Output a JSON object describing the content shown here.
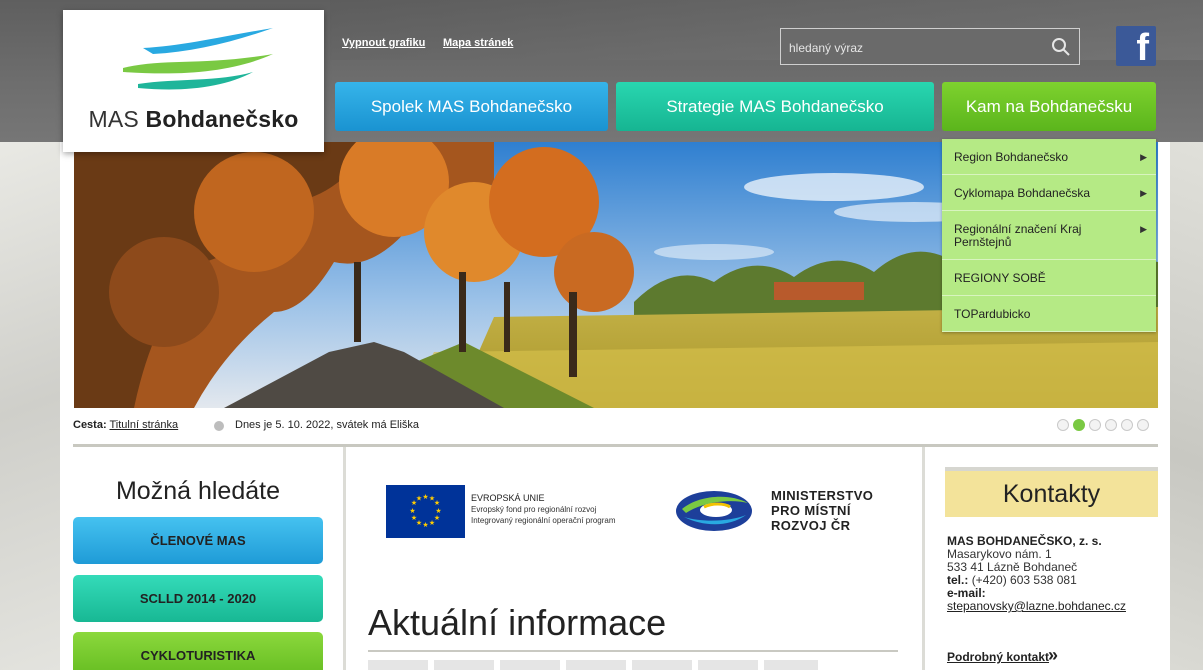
{
  "logo": {
    "prefix": "MAS",
    "name": "Bohdanečsko"
  },
  "top_links": {
    "grafika": "Vypnout grafiku",
    "mapa": "Mapa stránek"
  },
  "search": {
    "placeholder": "hledaný výraz"
  },
  "social": {
    "facebook_icon": "facebook-icon"
  },
  "nav": {
    "spolek": "Spolek MAS Bohdanečsko",
    "strategie": "Strategie MAS Bohdanečsko",
    "kam": "Kam na Bohdanečsku"
  },
  "dropdown": {
    "items": [
      {
        "label": "Region Bohdanečsko",
        "has_submenu": true
      },
      {
        "label": "Cyklomapa Bohdanečska",
        "has_submenu": true
      },
      {
        "label": "Regionální značení Kraj Pernštejnů",
        "has_submenu": true
      },
      {
        "label": "REGIONY SOBĚ",
        "has_submenu": false
      },
      {
        "label": "TOPardubicko",
        "has_submenu": false
      }
    ]
  },
  "breadcrumb": {
    "label": "Cesta:",
    "home": "Titulní stránka"
  },
  "date_text": "Dnes je 5. 10. 2022, svátek má Eliška",
  "slider": {
    "count": 6,
    "active_index": 1
  },
  "left": {
    "title": "Možná hledáte",
    "buttons": [
      "ČLENOVÉ MAS",
      "SCLLD 2014 - 2020",
      "CYKLOTURISTIKA"
    ]
  },
  "center": {
    "eu": {
      "title": "EVROPSKÁ UNIE",
      "line1": "Evropský fond pro regionální rozvoj",
      "line2": "Integrovaný regionální operační program"
    },
    "mmr": {
      "line1": "MINISTERSTVO",
      "line2": "PRO MÍSTNÍ",
      "line3": "ROZVOJ ČR"
    },
    "heading": "Aktuální informace"
  },
  "contacts": {
    "heading": "Kontakty",
    "org": "MAS BOHDANEČSKO, z. s.",
    "street": "Masarykovo nám. 1",
    "city": "533 41 Lázně Bohdaneč",
    "tel_label": "tel.:",
    "tel": "(+420) 603 538 081",
    "email_label": "e-mail:",
    "email": "stepanovsky@lazne.bohdanec.cz",
    "more": "Podrobný kontakt"
  },
  "colors": {
    "nav_blue": "#1a93d1",
    "nav_teal": "#16b592",
    "nav_green": "#5bb51c",
    "dropdown_bg": "#b5ea85",
    "contacts_head_bg": "#f3e39a",
    "facebook": "#3b5998"
  }
}
